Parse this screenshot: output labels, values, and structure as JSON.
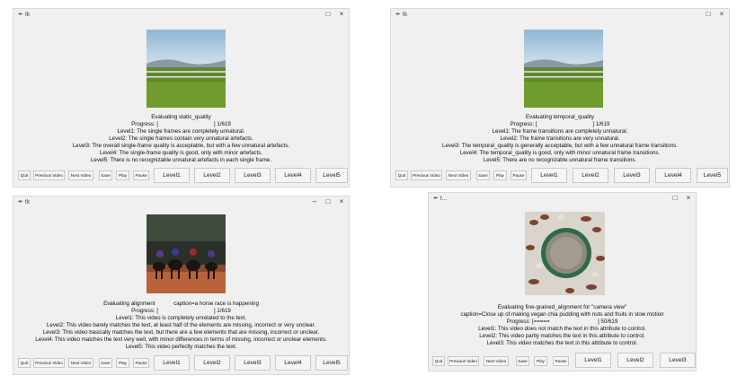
{
  "windows": [
    {
      "title": "tk",
      "eval_line": "Evaluating static_quality",
      "progress": "Progress: [                                    ] 1/619",
      "levels": [
        "Level1: The single frames are completely unnatural.",
        "Level2: The single frames contain very unnatural artefacts.",
        "Level3: The overall single-frame quality is acceptable, but with a few unnatural artefacts.",
        "Level4: The single-frame quality is good, only with minor artefacts.",
        "Level5: There is no recognizable unnatural artefacts in each single frame."
      ],
      "buttons": {
        "quit": "Quit",
        "prev": "Previous Video",
        "next": "Next Video",
        "save": "Save",
        "play": "Play",
        "pause": "Pause",
        "level_buttons": [
          "Level1",
          "Level2",
          "Level3",
          "Level4",
          "Level5"
        ]
      }
    },
    {
      "title": "tk",
      "eval_line": "Evaluating temporal_quality",
      "progress": "Progress: [                                    ] 1/619",
      "levels": [
        "Level1: The frame transitions are completely unnatural.",
        "Level2: The frame transitions are very unnatural.",
        "Level3: The temporal_quality is generally acceptable, but with a few unnatural frame transitions.",
        "Level4: The temporal_quality is good, only with minor unnatural frame transitions.",
        "Level5: There are no recognizable unnatural frame transitions."
      ],
      "buttons": {
        "quit": "Quit",
        "prev": "Previous Video",
        "next": "Next Video",
        "save": "Save",
        "play": "Play",
        "pause": "Pause",
        "level_buttons": [
          "Level1",
          "Level2",
          "Level3",
          "Level4",
          "Level5"
        ]
      }
    },
    {
      "title": "tk",
      "eval_line": "Evaluating alignment            caption=a horse race is happening",
      "progress": "Progress: [                                    ] 1/619",
      "levels": [
        "Level1: This video is completely unrelated to the text.",
        "Level2: This video barely matches the text, at least half of the elements are missing, incorrect or very unclear.",
        "Level3: This video basically matches the text, but there are a few elements that are missing, incorrect or unclear.",
        "Level4: This video matches the text very well, with minor differences in terms of missing, incorrect or unclear elements.",
        "Level5: This video perfectly matches the text."
      ],
      "buttons": {
        "quit": "Quit",
        "prev": "Previous Video",
        "next": "Next Video",
        "save": "Save",
        "play": "Play",
        "pause": "Pause",
        "level_buttons": [
          "Level1",
          "Level2",
          "Level3",
          "Level4",
          "Level5"
        ]
      }
    },
    {
      "title": "t...",
      "eval_line": "Evaluating fine-grained_alignment for \"camera view\"",
      "caption_line": "caption=Close up of making vegan chia pudding with nuts and fruits in slow motion",
      "progress": "Progress: [=====                               ] 50/619",
      "levels": [
        "Level1: This video does not match the text in this attribute to control.",
        "Level2: This video partly matches the text in this attribute to control.",
        "Level3: This video matches the text in this attribute to control."
      ],
      "buttons": {
        "quit": "Quit",
        "prev": "Previous Video",
        "next": "Next Video",
        "save": "Save",
        "play": "Play",
        "pause": "Pause",
        "level_buttons": [
          "Level1",
          "Level2",
          "Level3"
        ]
      }
    }
  ],
  "window_controls": {
    "minimize": "–",
    "maximize": "□",
    "close": "×"
  }
}
